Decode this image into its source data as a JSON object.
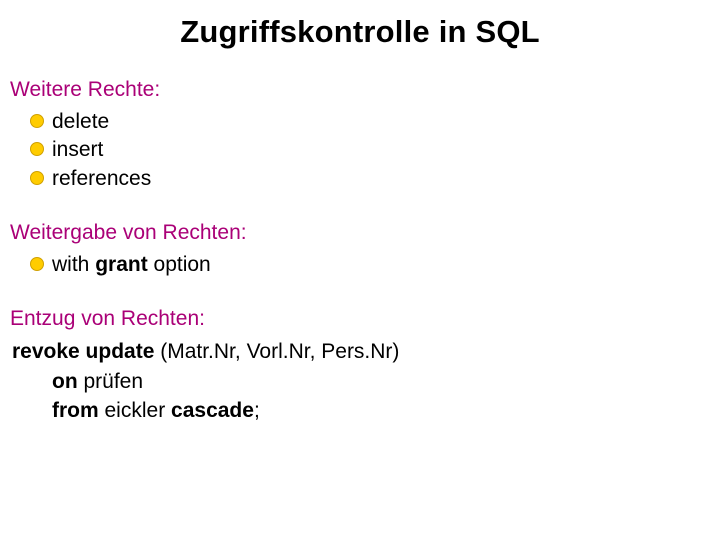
{
  "title": "Zugriffskontrolle in SQL",
  "sections": {
    "more_rights": {
      "heading": "Weitere Rechte:",
      "items": [
        "delete",
        "insert",
        "references"
      ]
    },
    "pass_on": {
      "heading": "Weitergabe von Rechten:",
      "item_prefix": "with ",
      "item_grant": "grant",
      "item_suffix": " option"
    },
    "revoke": {
      "heading": "Entzug von Rechten:",
      "line1_kw": "revoke update",
      "line1_rest": " (Matr.Nr, Vorl.Nr, Pers.Nr)",
      "line2_kw": "on",
      "line2_rest": " prüfen",
      "line3_kw1": "from",
      "line3_mid": " eickler ",
      "line3_kw2": "cascade",
      "line3_end": ";"
    }
  }
}
